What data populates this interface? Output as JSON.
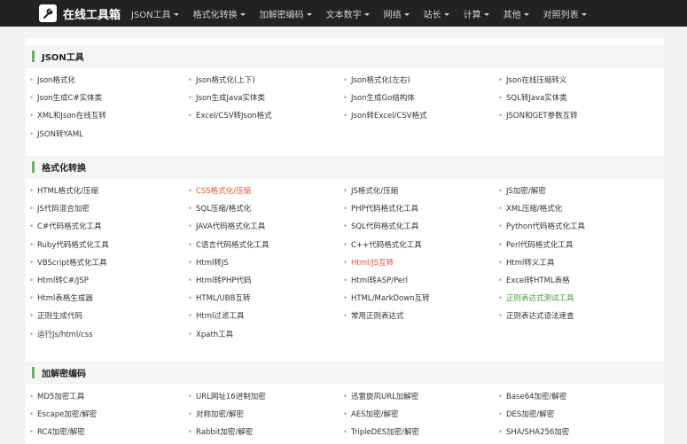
{
  "brand": {
    "title": "在线工具箱",
    "icon": "wrench-icon"
  },
  "nav": [
    {
      "label": "JSON工具",
      "caret": true
    },
    {
      "label": "格式化转换",
      "caret": true
    },
    {
      "label": "加解密编码",
      "caret": true
    },
    {
      "label": "文本数字",
      "caret": true
    },
    {
      "label": "网络",
      "caret": true
    },
    {
      "label": "站长",
      "caret": true
    },
    {
      "label": "计算",
      "caret": true
    },
    {
      "label": "其他",
      "caret": true
    },
    {
      "label": "对照列表",
      "caret": true
    }
  ],
  "colors": {
    "accent": "#5cb85c",
    "topbar": "#222222",
    "highlight_red": "#e55234",
    "highlight_green": "#4a9a3e"
  },
  "sections": [
    {
      "title": "JSON工具",
      "items": [
        {
          "label": "Json格式化"
        },
        {
          "label": "Json格式化(上下)"
        },
        {
          "label": "Json格式化(左右)"
        },
        {
          "label": "Json在线压缩转义"
        },
        {
          "label": "Json生成C#实体类"
        },
        {
          "label": "Json生成Java实体类"
        },
        {
          "label": "Json生成Go结构体"
        },
        {
          "label": "SQL转Java实体类"
        },
        {
          "label": "XML和Json在线互转"
        },
        {
          "label": "Excel/CSV转Json格式"
        },
        {
          "label": "Json转Excel/CSV格式"
        },
        {
          "label": "JSON和GET参数互转"
        },
        {
          "label": "JSON转YAML"
        }
      ]
    },
    {
      "title": "格式化转换",
      "items": [
        {
          "label": "HTML格式化/压缩"
        },
        {
          "label": "CSS格式化/压缩",
          "style": "red"
        },
        {
          "label": "JS格式化/压缩"
        },
        {
          "label": "JS加密/解密"
        },
        {
          "label": "JS代码混合加密"
        },
        {
          "label": "SQL压缩/格式化"
        },
        {
          "label": "PHP代码格式化工具"
        },
        {
          "label": "XML压缩/格式化"
        },
        {
          "label": "C#代码格式化工具"
        },
        {
          "label": "JAVA代码格式化工具"
        },
        {
          "label": "SQL代码格式化工具"
        },
        {
          "label": "Python代码格式化工具"
        },
        {
          "label": "Ruby代码格式化工具"
        },
        {
          "label": "C语言代码格式化工具"
        },
        {
          "label": "C++代码格式化工具"
        },
        {
          "label": "Perl代码格式化工具"
        },
        {
          "label": "VBScript格式化工具"
        },
        {
          "label": "Html转JS"
        },
        {
          "label": "Html/JS互转",
          "style": "red"
        },
        {
          "label": "Html转义工具"
        },
        {
          "label": "Html转C#/JSP"
        },
        {
          "label": "Html转PHP代码"
        },
        {
          "label": "Html转ASP/Perl"
        },
        {
          "label": "Excel转HTML表格"
        },
        {
          "label": "Html表格生成器"
        },
        {
          "label": "HTML/UBB互转"
        },
        {
          "label": "HTML/MarkDown互转"
        },
        {
          "label": "正则表达式测试工具",
          "style": "green"
        },
        {
          "label": "正则生成代码"
        },
        {
          "label": "Html过滤工具"
        },
        {
          "label": "常用正则表达式"
        },
        {
          "label": "正则表达式语法速查"
        },
        {
          "label": "运行Js/html/css"
        },
        {
          "label": "Xpath工具"
        }
      ]
    },
    {
      "title": "加解密编码",
      "items": [
        {
          "label": "MD5加密工具"
        },
        {
          "label": "URL网址16进制加密"
        },
        {
          "label": "迅雷旋风URL加解密"
        },
        {
          "label": "Base64加密/解密"
        },
        {
          "label": "Escape加密/解密"
        },
        {
          "label": "对称加密/解密"
        },
        {
          "label": "AES加密/解密"
        },
        {
          "label": "DES加密/解密"
        },
        {
          "label": "RC4加密/解密"
        },
        {
          "label": "Rabbit加密/解密"
        },
        {
          "label": "TripleDES加密/解密"
        },
        {
          "label": "SHA/SHA256加密"
        }
      ]
    }
  ]
}
